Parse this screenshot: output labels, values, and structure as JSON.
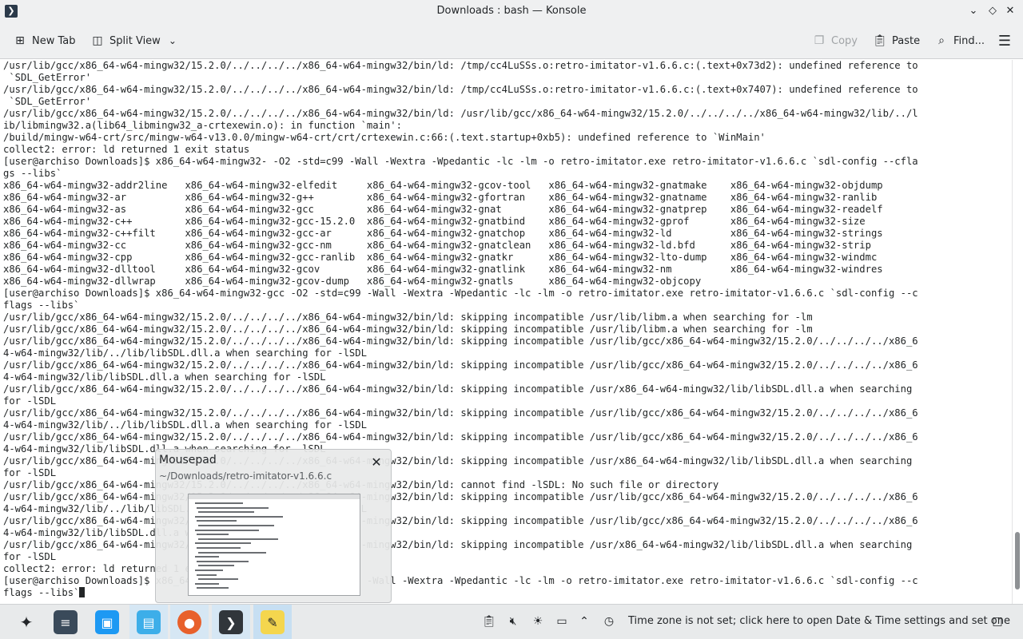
{
  "window": {
    "title": "Downloads : bash — Konsole"
  },
  "toolbar": {
    "new_tab": "New Tab",
    "split_view": "Split View",
    "copy": "Copy",
    "paste": "Paste",
    "find": "Find..."
  },
  "terminal": {
    "lines": [
      "/usr/lib/gcc/x86_64-w64-mingw32/15.2.0/../../../../x86_64-w64-mingw32/bin/ld: /tmp/cc4LuSSs.o:retro-imitator-v1.6.6.c:(.text+0x73d2): undefined reference to",
      " `SDL_GetError'",
      "/usr/lib/gcc/x86_64-w64-mingw32/15.2.0/../../../../x86_64-w64-mingw32/bin/ld: /tmp/cc4LuSSs.o:retro-imitator-v1.6.6.c:(.text+0x7407): undefined reference to",
      " `SDL_GetError'",
      "/usr/lib/gcc/x86_64-w64-mingw32/15.2.0/../../../../x86_64-w64-mingw32/bin/ld: /usr/lib/gcc/x86_64-w64-mingw32/15.2.0/../../../../x86_64-w64-mingw32/lib/../l",
      "ib/libmingw32.a(lib64_libmingw32_a-crtexewin.o): in function `main':",
      "/build/mingw-w64-crt/src/mingw-w64-v13.0.0/mingw-w64-crt/crt/crtexewin.c:66:(.text.startup+0xb5): undefined reference to `WinMain'",
      "collect2: error: ld returned 1 exit status",
      "[user@archiso Downloads]$ x86_64-w64-mingw32- -O2 -std=c99 -Wall -Wextra -Wpedantic -lc -lm -o retro-imitator.exe retro-imitator-v1.6.6.c `sdl-config --cfla",
      "gs --libs`",
      "x86_64-w64-mingw32-addr2line   x86_64-w64-mingw32-elfedit     x86_64-w64-mingw32-gcov-tool   x86_64-w64-mingw32-gnatmake    x86_64-w64-mingw32-objdump",
      "x86_64-w64-mingw32-ar          x86_64-w64-mingw32-g++         x86_64-w64-mingw32-gfortran    x86_64-w64-mingw32-gnatname    x86_64-w64-mingw32-ranlib",
      "x86_64-w64-mingw32-as          x86_64-w64-mingw32-gcc         x86_64-w64-mingw32-gnat        x86_64-w64-mingw32-gnatprep    x86_64-w64-mingw32-readelf",
      "x86_64-w64-mingw32-c++         x86_64-w64-mingw32-gcc-15.2.0  x86_64-w64-mingw32-gnatbind    x86_64-w64-mingw32-gprof       x86_64-w64-mingw32-size",
      "x86_64-w64-mingw32-c++filt     x86_64-w64-mingw32-gcc-ar      x86_64-w64-mingw32-gnatchop    x86_64-w64-mingw32-ld          x86_64-w64-mingw32-strings",
      "x86_64-w64-mingw32-cc          x86_64-w64-mingw32-gcc-nm      x86_64-w64-mingw32-gnatclean   x86_64-w64-mingw32-ld.bfd      x86_64-w64-mingw32-strip",
      "x86_64-w64-mingw32-cpp         x86_64-w64-mingw32-gcc-ranlib  x86_64-w64-mingw32-gnatkr      x86_64-w64-mingw32-lto-dump    x86_64-w64-mingw32-windmc",
      "x86_64-w64-mingw32-dlltool     x86_64-w64-mingw32-gcov        x86_64-w64-mingw32-gnatlink    x86_64-w64-mingw32-nm          x86_64-w64-mingw32-windres",
      "x86_64-w64-mingw32-dllwrap     x86_64-w64-mingw32-gcov-dump   x86_64-w64-mingw32-gnatls      x86_64-w64-mingw32-objcopy",
      "[user@archiso Downloads]$ x86_64-w64-mingw32-gcc -O2 -std=c99 -Wall -Wextra -Wpedantic -lc -lm -o retro-imitator.exe retro-imitator-v1.6.6.c `sdl-config --c",
      "flags --libs`",
      "/usr/lib/gcc/x86_64-w64-mingw32/15.2.0/../../../../x86_64-w64-mingw32/bin/ld: skipping incompatible /usr/lib/libm.a when searching for -lm",
      "/usr/lib/gcc/x86_64-w64-mingw32/15.2.0/../../../../x86_64-w64-mingw32/bin/ld: skipping incompatible /usr/lib/libm.a when searching for -lm",
      "/usr/lib/gcc/x86_64-w64-mingw32/15.2.0/../../../../x86_64-w64-mingw32/bin/ld: skipping incompatible /usr/lib/gcc/x86_64-w64-mingw32/15.2.0/../../../../x86_6",
      "4-w64-mingw32/lib/../lib/libSDL.dll.a when searching for -lSDL",
      "/usr/lib/gcc/x86_64-w64-mingw32/15.2.0/../../../../x86_64-w64-mingw32/bin/ld: skipping incompatible /usr/lib/gcc/x86_64-w64-mingw32/15.2.0/../../../../x86_6",
      "4-w64-mingw32/lib/libSDL.dll.a when searching for -lSDL",
      "/usr/lib/gcc/x86_64-w64-mingw32/15.2.0/../../../../x86_64-w64-mingw32/bin/ld: skipping incompatible /usr/x86_64-w64-mingw32/lib/libSDL.dll.a when searching",
      "for -lSDL",
      "/usr/lib/gcc/x86_64-w64-mingw32/15.2.0/../../../../x86_64-w64-mingw32/bin/ld: skipping incompatible /usr/lib/gcc/x86_64-w64-mingw32/15.2.0/../../../../x86_6",
      "4-w64-mingw32/lib/../lib/libSDL.dll.a when searching for -lSDL",
      "/usr/lib/gcc/x86_64-w64-mingw32/15.2.0/../../../../x86_64-w64-mingw32/bin/ld: skipping incompatible /usr/lib/gcc/x86_64-w64-mingw32/15.2.0/../../../../x86_6",
      "4-w64-mingw32/lib/libSDL.dll.a when searching for -lSDL",
      "/usr/lib/gcc/x86_64-w64-mingw32/15.2.0/../../../../x86_64-w64-mingw32/bin/ld: skipping incompatible /usr/x86_64-w64-mingw32/lib/libSDL.dll.a when searching",
      "for -lSDL",
      "/usr/lib/gcc/x86_64-w64-mingw32/15.2.0/../../../../x86_64-w64-mingw32/bin/ld: cannot find -lSDL: No such file or directory",
      "/usr/lib/gcc/x86_64-w64-mingw32/15.2.0/../../../../x86_64-w64-mingw32/bin/ld: skipping incompatible /usr/lib/gcc/x86_64-w64-mingw32/15.2.0/../../../../x86_6",
      "4-w64-mingw32/lib/../lib/libSDL.dll.a when searching for -lSDL",
      "/usr/lib/gcc/x86_64-w64-mingw32/15.2.0/../../../../x86_64-w64-mingw32/bin/ld: skipping incompatible /usr/lib/gcc/x86_64-w64-mingw32/15.2.0/../../../../x86_6",
      "4-w64-mingw32/lib/libSDL.dll.a when searching for -lSDL",
      "/usr/lib/gcc/x86_64-w64-mingw32/15.2.0/../../../../x86_64-w64-mingw32/bin/ld: skipping incompatible /usr/x86_64-w64-mingw32/lib/libSDL.dll.a when searching",
      "for -lSDL",
      "collect2: error: ld returned 1 exit status",
      "[user@archiso Downloads]$ x86_64-w64-mingw32-gcc -O2 -std=c99 -Wall -Wextra -Wpedantic -lc -lm -o retro-imitator.exe retro-imitator-v1.6.6.c `sdl-config --c"
    ],
    "last_line": "flags --libs`"
  },
  "popup": {
    "title": "Mousepad",
    "path": "~/Downloads/retro-imitator-v1.6.6.c"
  },
  "taskbar": {
    "apps": [
      {
        "name": "launcher-icon"
      },
      {
        "name": "system-settings-icon"
      },
      {
        "name": "discover-store-icon"
      },
      {
        "name": "file-manager-icon"
      },
      {
        "name": "firefox-icon"
      },
      {
        "name": "konsole-icon"
      },
      {
        "name": "mousepad-icon"
      }
    ],
    "tray_icons": [
      "clipboard-icon",
      "volume-muted-icon",
      "brightness-icon",
      "display-icon",
      "expand-tray-icon",
      "clock-warning-icon"
    ],
    "timezone_notice": "Time zone is not set; click here to open Date & Time settings and set one"
  },
  "colors": {
    "accent": "#3daee9",
    "window_bg": "#eff0f1",
    "terminal_bg": "#ffffff",
    "terminal_fg": "#232627"
  },
  "scroll": {
    "position_fraction": 0.97
  }
}
